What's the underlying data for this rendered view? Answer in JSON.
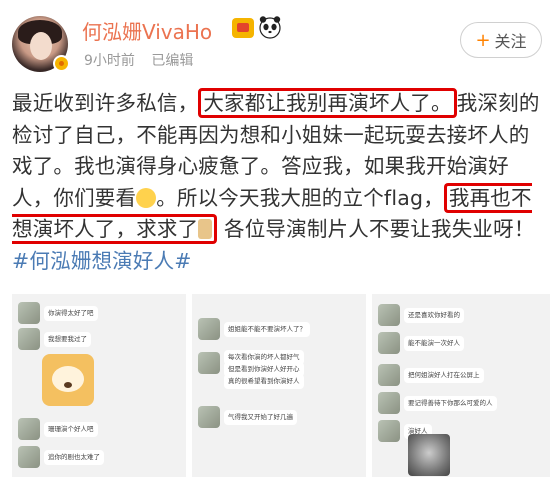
{
  "header": {
    "username": "何泓姗VivaHo",
    "time": "9小时前",
    "edited": "已编辑",
    "follow_label": "关注",
    "follow_plus": "+"
  },
  "post": {
    "seg1": "最近收到许多私信，",
    "box1": "大家都让我别再演坏人了。",
    "seg2": "我深刻的检讨了自己，不能再因为想和小姐妹一起玩耍去接坏人的戏了。我也演得身心疲惫了。答应我，如果我开始演好人，你们要看",
    "seg3": "。所以今天我大胆的立个flag，",
    "box2": "我再也不想演坏人了，求求了",
    "seg4": " 各位导演制片人不要让我失业呀！",
    "hashtag": "#何泓姗想演好人#"
  },
  "images": {
    "shot1": {
      "msgs": [
        "你演得太好了吧",
        "我想要我过了",
        "珊珊演个好人吧",
        "追你的剧也太难了"
      ]
    },
    "shot2": {
      "msgs": [
        "姐姐能不能不要演坏人了？",
        "每次看你演的坏人都好气",
        "但是看到你演好人好开心",
        "真的很希望看到你演好人",
        "气得我又开始了好几遍"
      ]
    },
    "shot3": {
      "msgs": [
        "还是喜欢你好看的",
        "能不能演一次好人",
        "把何姐演好人打在公屏上",
        "要记得善待下你那么可爱的人",
        "演好人"
      ]
    }
  },
  "colors": {
    "username": "#eb7350",
    "highlight_border": "#e00000",
    "hashtag": "#4b7bb4",
    "follow_plus": "#ff8200"
  }
}
